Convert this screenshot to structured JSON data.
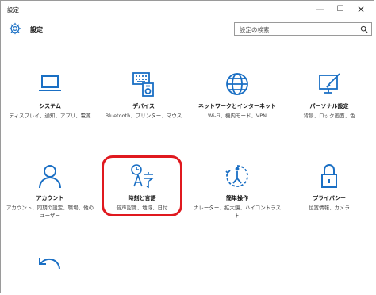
{
  "window": {
    "title": "設定",
    "minimize": "—",
    "maximize": "☐",
    "close": "✕"
  },
  "header": {
    "title": "設定",
    "search_placeholder": "設定の検索"
  },
  "tiles": [
    {
      "title": "システム",
      "desc": "ディスプレイ、通知、アプリ、電源",
      "icon": "laptop-icon"
    },
    {
      "title": "デバイス",
      "desc": "Bluetooth、プリンター、マウス",
      "icon": "devices-icon"
    },
    {
      "title": "ネットワークとインターネット",
      "desc": "Wi-Fi、機内モード、VPN",
      "icon": "globe-icon"
    },
    {
      "title": "パーソナル設定",
      "desc": "背景、ロック画面、色",
      "icon": "personalization-icon"
    },
    {
      "title": "アカウント",
      "desc": "アカウント、同期の設定、職場、他のユーザー",
      "icon": "person-icon"
    },
    {
      "title": "時刻と言語",
      "desc": "音声認識、地域、日付",
      "icon": "time-language-icon"
    },
    {
      "title": "簡単操作",
      "desc": "ナレーター、拡大鏡、ハイコントラスト",
      "icon": "ease-of-access-icon"
    },
    {
      "title": "プライバシー",
      "desc": "位置情報、カメラ",
      "icon": "lock-icon"
    }
  ],
  "accent_color": "#1a6fc4",
  "highlight_color": "#e0191f"
}
